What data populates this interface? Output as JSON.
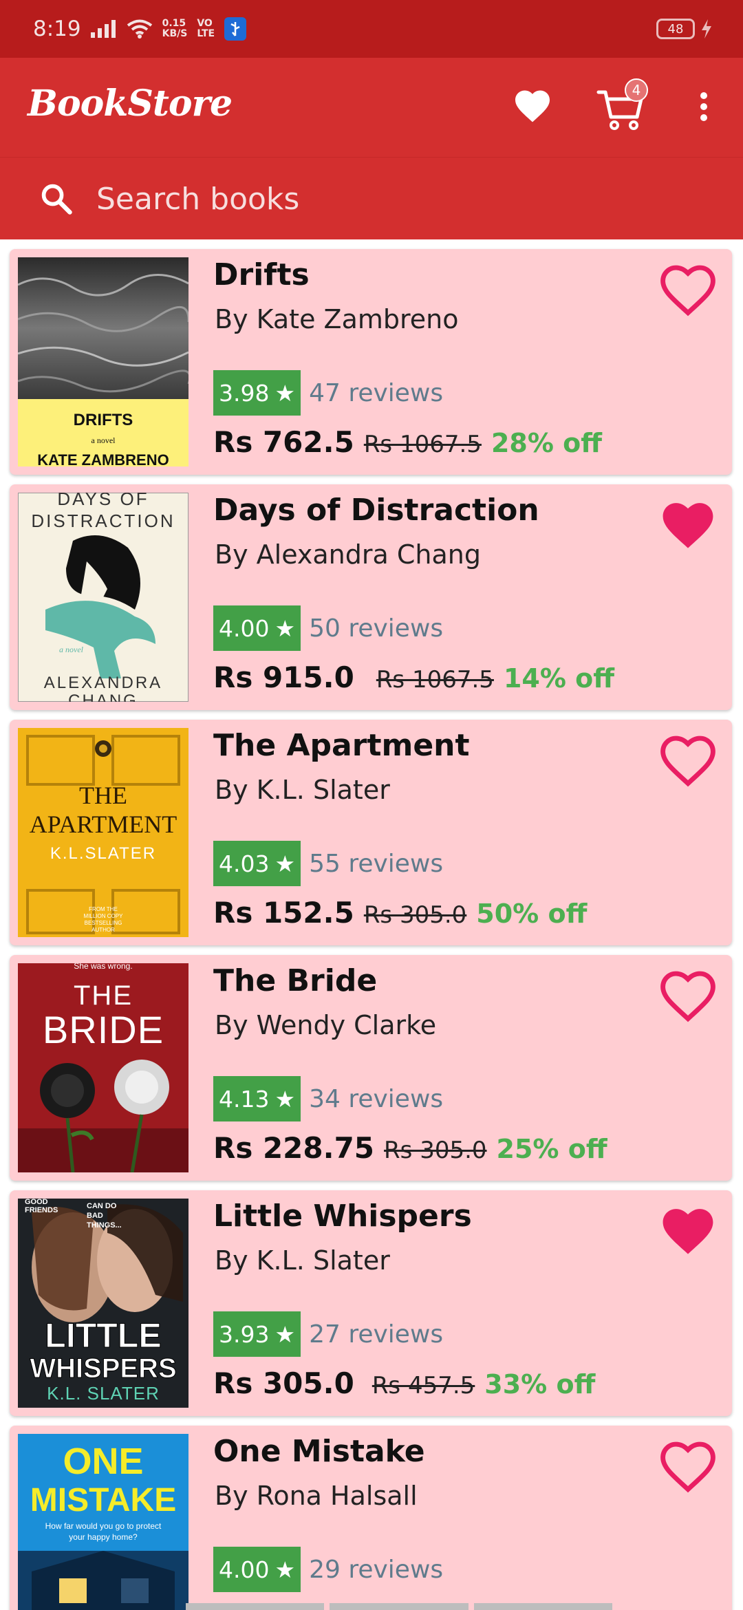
{
  "status_bar": {
    "time": "8:19",
    "net_speed": "0.15",
    "net_unit": "KB/S",
    "net_type_top": "VO",
    "net_type_bottom": "LTE",
    "battery": "48"
  },
  "app_bar": {
    "title": "BookStore",
    "cart_count": "4"
  },
  "search": {
    "placeholder": "Search books"
  },
  "books": [
    {
      "title": "Drifts",
      "author": "By Kate Zambreno",
      "rating": "3.98",
      "reviews": "47 reviews",
      "price": "Rs 762.5",
      "mrp": "Rs 1067.5",
      "discount": "28% off",
      "favorite": false,
      "cover_text": [
        "DRIFTS",
        "a novel",
        "KATE ZAMBRENO"
      ]
    },
    {
      "title": "Days of Distraction",
      "author": "By Alexandra Chang",
      "rating": "4.00",
      "reviews": "50 reviews",
      "price": "Rs 915.0",
      "mrp": "Rs 1067.5",
      "discount": "14% off",
      "favorite": true,
      "cover_text": [
        "DAYS OF",
        "DISTRACTION",
        "a novel",
        "ALEXANDRA",
        "CHANG"
      ]
    },
    {
      "title": "The Apartment",
      "author": "By K.L. Slater",
      "rating": "4.03",
      "reviews": "55 reviews",
      "price": "Rs 152.5",
      "mrp": "Rs 305.0",
      "discount": "50% off",
      "favorite": false,
      "cover_text": [
        "THE",
        "APARTMENT",
        "K.L.SLATER",
        "FROM THE",
        "MILLION COPY",
        "BESTSELLING",
        "AUTHOR"
      ]
    },
    {
      "title": "The Bride",
      "author": "By Wendy Clarke",
      "rating": "4.13",
      "reviews": "34 reviews",
      "price": "Rs 228.75",
      "mrp": "Rs 305.0",
      "discount": "25% off",
      "favorite": false,
      "cover_text": [
        "She was wrong.",
        "THE",
        "BRIDE"
      ]
    },
    {
      "title": "Little Whispers",
      "author": "By K.L. Slater",
      "rating": "3.93",
      "reviews": "27 reviews",
      "price": "Rs 305.0",
      "mrp": "Rs 457.5",
      "discount": "33% off",
      "favorite": true,
      "cover_text": [
        "GOOD",
        "FRIENDS",
        "CAN DO",
        "BAD",
        "THINGS...",
        "LITTLE",
        "WHISPERS",
        "K.L. SLATER"
      ]
    },
    {
      "title": "One Mistake",
      "author": "By Rona Halsall",
      "rating": "4.00",
      "reviews": "29 reviews",
      "price": "",
      "mrp": "",
      "discount": "",
      "favorite": false,
      "cover_text": [
        "ONE",
        "MISTAKE",
        "How far would you go to protect",
        "your happy home?"
      ]
    }
  ],
  "colors": {
    "primary": "#d32f2f",
    "primary_dark": "#b71c1c",
    "card": "#ffcdd2",
    "rating": "#43a047",
    "discount": "#4caf50",
    "favorite": "#e91e63"
  }
}
